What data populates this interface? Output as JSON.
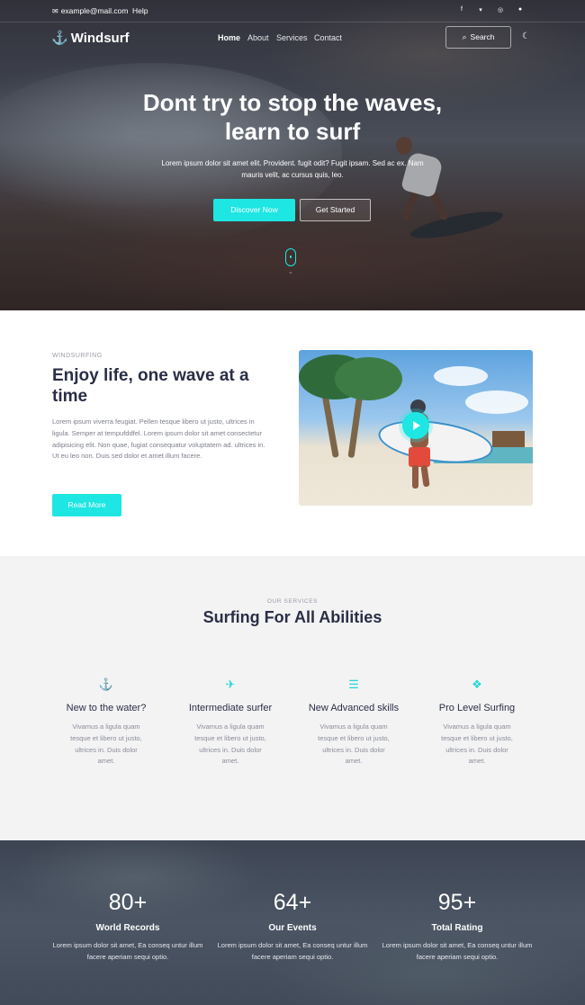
{
  "topbar": {
    "email": "example@mail.com",
    "help": "Help",
    "social": [
      "facebook-icon",
      "twitter-icon",
      "instagram-icon",
      "pinterest-icon"
    ]
  },
  "nav": {
    "brand": "Windsurf",
    "links": [
      "Home",
      "About",
      "Services",
      "Contact"
    ],
    "active": "Home",
    "search_label": "Search"
  },
  "hero": {
    "title": "Dont try to stop the waves, learn to surf",
    "subtitle": "Lorem ipsum dolor sit amet elit. Provident. fugit odit? Fugit ipsam. Sed ac ex. Nam mauris velit, ac cursus quis, leo.",
    "primary_button": "Discover Now",
    "secondary_button": "Get Started"
  },
  "about": {
    "eyebrow": "WINDSURFING",
    "title": "Enjoy life, one wave at a time",
    "body": "Lorem ipsum viverra feugiat. Pellen tesque libero ut justo, ultrices in ligula. Semper at tempufddfel. Lorem ipsum dolor sit amet consectetur adipisicing elit. Non quae, fugiat consequatur voluptatem ad. ultrices in. Ut eu leo non. Duis sed dolor et amet illum facere.",
    "button": "Read More"
  },
  "services": {
    "eyebrow": "OUR SERVICES",
    "title": "Surfing For All Abilities",
    "items": [
      {
        "icon": "anchor-icon",
        "name": "New to the water?",
        "desc": "Vivamus a ligula quam tesque et libero ut justo, ultrices in. Duis dolor amet."
      },
      {
        "icon": "surf-icon",
        "name": "Intermediate surfer",
        "desc": "Vivamus a ligula quam tesque et libero ut justo, ultrices in. Duis dolor amet."
      },
      {
        "icon": "list-icon",
        "name": "New Advanced skills",
        "desc": "Vivamus a ligula quam tesque et libero ut justo, ultrices in. Duis dolor amet."
      },
      {
        "icon": "users-icon",
        "name": "Pro Level Surfing",
        "desc": "Vivamus a ligula quam tesque et libero ut justo, ultrices in. Duis dolor amet."
      }
    ]
  },
  "stats": [
    {
      "number": "80+",
      "label": "World Records",
      "desc": "Lorem ipsum dolor sit amet, Ea conseq untur illum facere aperiam sequi optio."
    },
    {
      "number": "64+",
      "label": "Our Events",
      "desc": "Lorem ipsum dolor sit amet, Ea conseq untur illum facere aperiam sequi optio."
    },
    {
      "number": "95+",
      "label": "Total Rating",
      "desc": "Lorem ipsum dolor sit amet, Ea conseq untur illum facere aperiam sequi optio."
    }
  ],
  "colors": {
    "accent": "#1ee6e2",
    "heading": "#2a2e45"
  }
}
